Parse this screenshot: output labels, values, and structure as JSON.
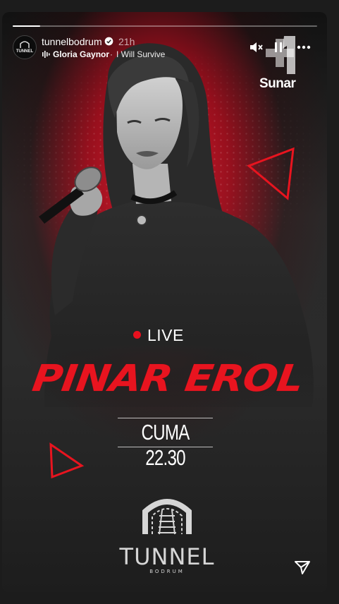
{
  "story": {
    "progress_fraction": 0.09,
    "username": "tunnelbodrum",
    "time_ago": "21h",
    "music": {
      "artist": "Gloria Gaynor",
      "separator": "·",
      "song": "I Will Survive"
    },
    "controls": {
      "mute_icon": "muted-speaker-icon",
      "pause_icon": "pause-icon",
      "more_icon": "more-dots-icon",
      "share_icon": "send-icon"
    }
  },
  "poster": {
    "sunar_label": "Sunar",
    "live_label": "LIVE",
    "performer": "PINAR EROL",
    "showtime": "CUMA 22.30",
    "venue_logo_text": "TUNNEL",
    "venue_logo_subtext": "BODRUM",
    "avatar_text": "TUNNEL",
    "accent_color": "#e8141f"
  }
}
